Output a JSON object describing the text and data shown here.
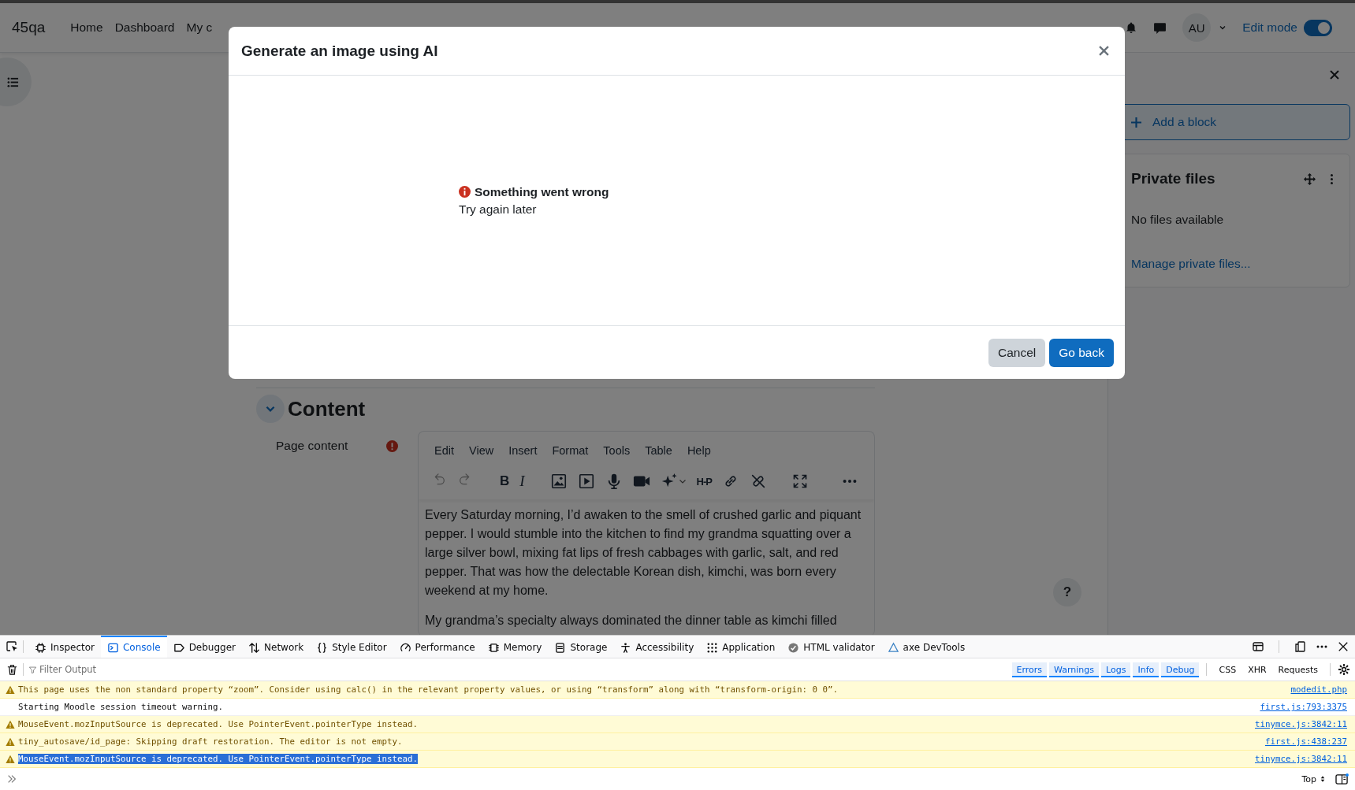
{
  "navbar": {
    "site_name": "45qa",
    "links": [
      "Home",
      "Dashboard",
      "My c"
    ],
    "avatar": "AU",
    "edit_mode": {
      "label": "Edit mode",
      "on": true
    }
  },
  "right_drawer": {
    "add_block": "Add a block",
    "block": {
      "title": "Private files",
      "text": "No files available",
      "link": "Manage private files..."
    }
  },
  "section": {
    "title": "Content",
    "expanded": true,
    "field_label": "Page content"
  },
  "editor": {
    "menu": [
      "Edit",
      "View",
      "Insert",
      "Format",
      "Tools",
      "Table",
      "Help"
    ],
    "format_buttons": [
      "B",
      "I"
    ],
    "h5p_label": "H-P",
    "paragraphs": [
      "Every Saturday morning, I’d awaken to the smell of crushed garlic and piquant pepper. I would stumble into the kitchen to find my grandma squatting over a large silver bowl, mixing fat lips of fresh cabbages with garlic, salt, and red pepper. That was how the delectable Korean dish, kimchi, was born every weekend at my home.",
      "My grandma’s specialty always dominated the dinner table as kimchi filled"
    ]
  },
  "help_button": "?",
  "modal": {
    "title": "Generate an image using AI",
    "error": {
      "title": "Something went wrong",
      "message": "Try again later"
    },
    "buttons": [
      {
        "label": "Cancel",
        "kind": "secondary"
      },
      {
        "label": "Go back",
        "kind": "primary"
      }
    ]
  },
  "devtools": {
    "tabs": [
      {
        "label": "Inspector",
        "selected": false
      },
      {
        "label": "Console",
        "selected": true
      },
      {
        "label": "Debugger",
        "selected": false
      },
      {
        "label": "Network",
        "selected": false
      },
      {
        "label": "Style Editor",
        "selected": false
      },
      {
        "label": "Performance",
        "selected": false
      },
      {
        "label": "Memory",
        "selected": false
      },
      {
        "label": "Storage",
        "selected": false
      },
      {
        "label": "Accessibility",
        "selected": false
      },
      {
        "label": "Application",
        "selected": false
      },
      {
        "label": "HTML validator",
        "selected": false
      },
      {
        "label": "axe DevTools",
        "selected": false
      }
    ],
    "filter_placeholder": "Filter Output",
    "filters": [
      {
        "label": "Errors",
        "on": true
      },
      {
        "label": "Warnings",
        "on": true
      },
      {
        "label": "Logs",
        "on": true
      },
      {
        "label": "Info",
        "on": true
      },
      {
        "label": "Debug",
        "on": true
      },
      {
        "label": "CSS",
        "on": false
      },
      {
        "label": "XHR",
        "on": false
      },
      {
        "label": "Requests",
        "on": false
      }
    ],
    "messages": [
      {
        "kind": "warning",
        "text": "This page uses the non standard property “zoom”. Consider using calc() in the relevant property values, or using “transform” along with “transform-origin: 0 0”.",
        "source": "modedit.php",
        "selected": false
      },
      {
        "kind": "log",
        "text": "Starting Moodle session timeout warning.",
        "source": "first.js:793:3375",
        "selected": false
      },
      {
        "kind": "warning",
        "text": "MouseEvent.mozInputSource is deprecated. Use PointerEvent.pointerType instead.",
        "source": "tinymce.js:3842:11",
        "selected": false
      },
      {
        "kind": "warning",
        "text": "tiny_autosave/id_page: Skipping draft restoration. The editor is not empty.",
        "source": "first.js:438:237",
        "selected": false
      },
      {
        "kind": "warning",
        "text": "MouseEvent.mozInputSource is deprecated. Use PointerEvent.pointerType instead.",
        "source": "tinymce.js:3842:11",
        "selected": true
      }
    ],
    "context": "Top"
  }
}
